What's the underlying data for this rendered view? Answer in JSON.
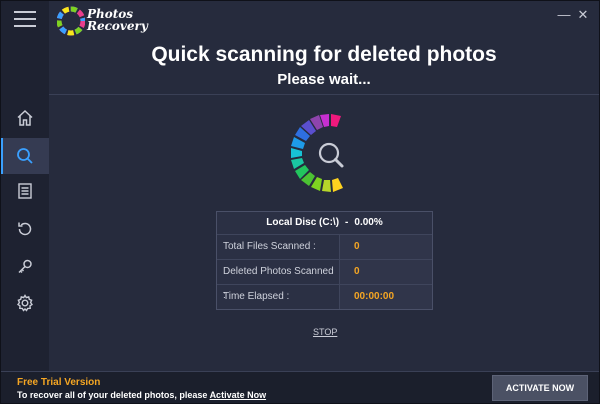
{
  "app": {
    "logo_line1": "Photos",
    "logo_line2": "Recovery",
    "minimize": "—",
    "close": "✕"
  },
  "sidebar": {
    "items": [
      {
        "name": "home",
        "icon": "home-icon",
        "active": false
      },
      {
        "name": "scan",
        "icon": "search-icon",
        "active": true
      },
      {
        "name": "list",
        "icon": "list-icon",
        "active": false
      },
      {
        "name": "restore",
        "icon": "restore-icon",
        "active": false
      },
      {
        "name": "key",
        "icon": "key-icon",
        "active": false
      },
      {
        "name": "settings",
        "icon": "gear-icon",
        "active": false
      }
    ]
  },
  "main": {
    "title": "Quick scanning for deleted photos",
    "subtitle": "Please wait...",
    "scan": {
      "disk_label": "Local Disc (C:\\)",
      "separator": "-",
      "disk_percent": "0.00%",
      "rows": [
        {
          "label": "Total Files Scanned :",
          "value": "0"
        },
        {
          "label": "Deleted Photos Scanned :",
          "value": "0"
        },
        {
          "label": "Time Elapsed :",
          "value": "00:00:00"
        }
      ]
    },
    "stop_label": "STOP"
  },
  "footer": {
    "trial_label": "Free Trial Version",
    "recover_text": "To recover all of your deleted photos, please",
    "activate_link": "Activate Now",
    "activate_button": "ACTIVATE NOW"
  },
  "colors": {
    "accent": "#3aa0ff",
    "value": "#f5a623",
    "background": "#262b3d",
    "sidebar": "#1e2231"
  }
}
